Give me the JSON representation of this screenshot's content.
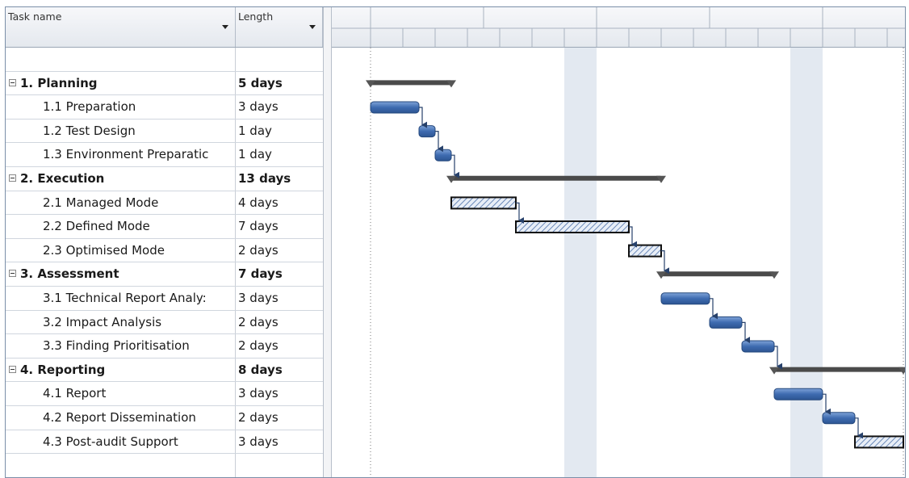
{
  "columns": {
    "task_name": "Task name",
    "length": "Length"
  },
  "tasks": [
    {
      "name": "",
      "length": "",
      "type": "blank"
    },
    {
      "name": "1. Planning",
      "length": "5 days",
      "type": "summary",
      "start": 0,
      "duration": 5
    },
    {
      "name": "1.1 Preparation",
      "length": "3 days",
      "type": "task",
      "start": 0,
      "duration": 3,
      "style": "solid"
    },
    {
      "name": "1.2 Test Design",
      "length": "1 day",
      "type": "task",
      "start": 3,
      "duration": 1,
      "style": "solid"
    },
    {
      "name": "1.3 Environment Preparatic",
      "length": "1 day",
      "type": "task",
      "start": 4,
      "duration": 1,
      "style": "solid"
    },
    {
      "name": "2. Execution",
      "length": "13 days",
      "type": "summary",
      "start": 5,
      "duration": 13
    },
    {
      "name": "2.1 Managed Mode",
      "length": "4 days",
      "type": "task",
      "start": 5,
      "duration": 4,
      "style": "hatched"
    },
    {
      "name": "2.2 Defined Mode",
      "length": "7 days",
      "type": "task",
      "start": 9,
      "duration": 7,
      "style": "hatched"
    },
    {
      "name": "2.3 Optimised Mode",
      "length": "2 days",
      "type": "task",
      "start": 16,
      "duration": 2,
      "style": "hatched"
    },
    {
      "name": "3. Assessment",
      "length": "7 days",
      "type": "summary",
      "start": 18,
      "duration": 7
    },
    {
      "name": "3.1 Technical Report Analy:",
      "length": "3 days",
      "type": "task",
      "start": 18,
      "duration": 3,
      "style": "solid"
    },
    {
      "name": "3.2 Impact Analysis",
      "length": "2 days",
      "type": "task",
      "start": 21,
      "duration": 2,
      "style": "solid"
    },
    {
      "name": "3.3 Finding Prioritisation",
      "length": "2 days",
      "type": "task",
      "start": 23,
      "duration": 2,
      "style": "solid"
    },
    {
      "name": "4. Reporting",
      "length": "8 days",
      "type": "summary",
      "start": 25,
      "duration": 8
    },
    {
      "name": "4.1 Report",
      "length": "3 days",
      "type": "task",
      "start": 25,
      "duration": 3,
      "style": "solid"
    },
    {
      "name": "4.2 Report Dissemination",
      "length": "2 days",
      "type": "task",
      "start": 28,
      "duration": 2,
      "style": "solid"
    },
    {
      "name": "4.3 Post-audit Support",
      "length": "3 days",
      "type": "task",
      "start": 30,
      "duration": 3,
      "style": "hatched"
    },
    {
      "name": "",
      "length": "",
      "type": "blank"
    }
  ],
  "timescale": {
    "day_columns": 33,
    "weekend_bands": [
      [
        12,
        14
      ],
      [
        26,
        28
      ]
    ]
  },
  "colors": {
    "bar": "#3e6bb0",
    "summary": "#4a4a4a",
    "weekend": "#e3e9f1",
    "arrow": "#27416b"
  }
}
